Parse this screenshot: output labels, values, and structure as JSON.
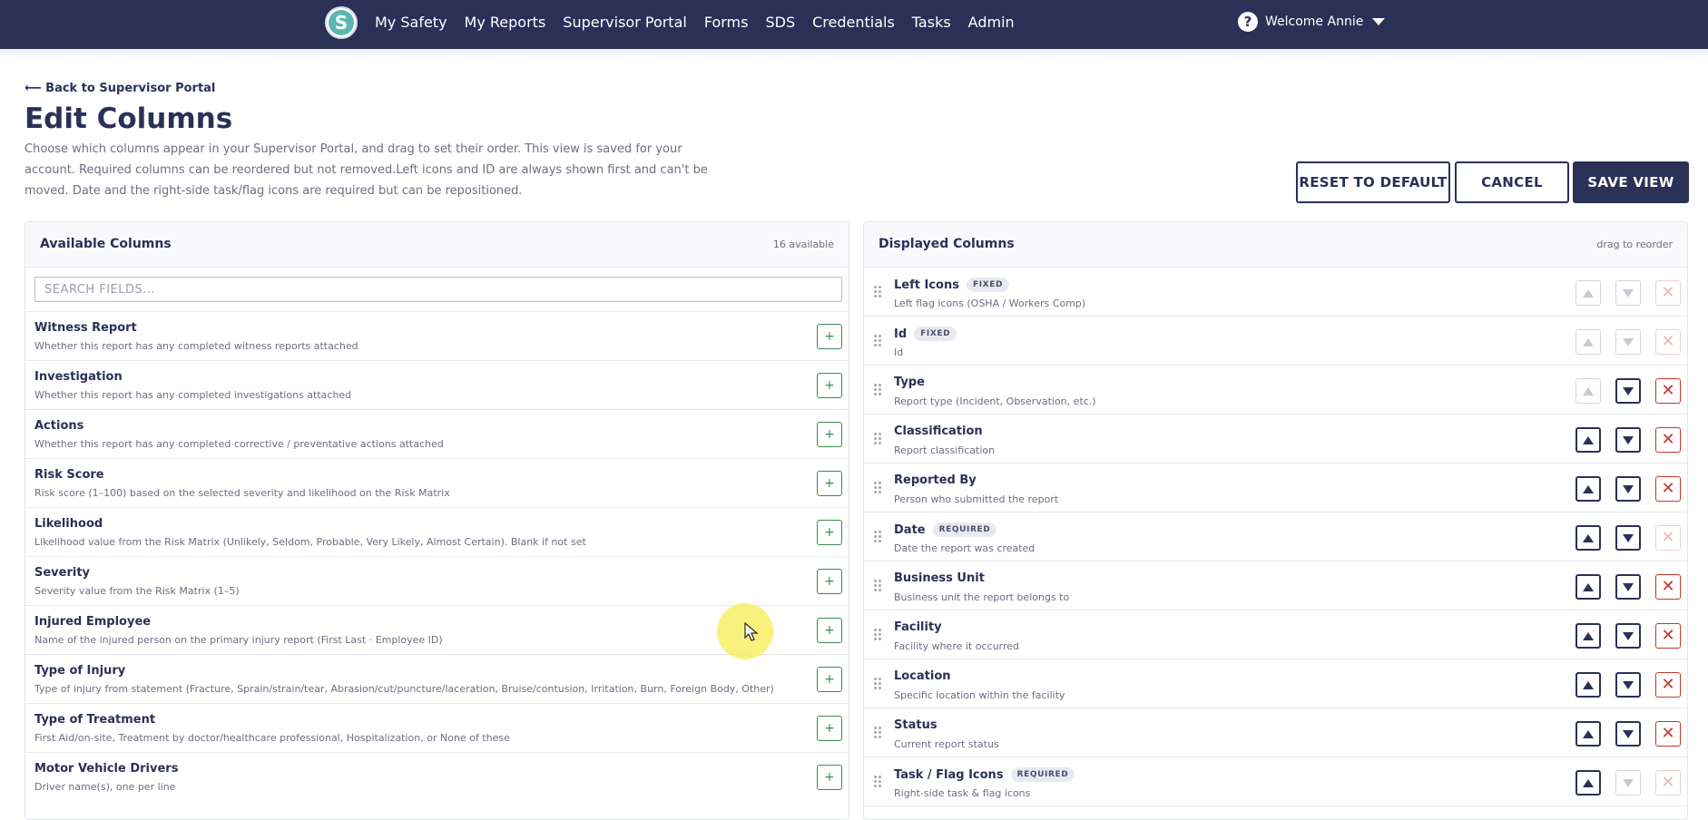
{
  "nav": {
    "logo_letter": "S",
    "links": [
      "My Safety",
      "My Reports",
      "Supervisor Portal",
      "Forms",
      "SDS",
      "Credentials",
      "Tasks",
      "Admin"
    ],
    "user_label": "Welcome Annie",
    "help_glyph": "?"
  },
  "header": {
    "back_label": "⟵ Back to Supervisor Portal",
    "title": "Edit Columns",
    "description": "Choose which columns appear in your Supervisor Portal, and drag to set their order. This view is saved for your account. Required columns can be reordered but not removed.Left icons and ID are always shown first and can't be moved. Date and the right-side task/flag icons are required but can be repositioned."
  },
  "actions": {
    "reset_label": "RESET TO DEFAULT",
    "cancel_label": "CANCEL",
    "save_label": "SAVE VIEW"
  },
  "available": {
    "title": "Available Columns",
    "count_label": "16 available",
    "search_placeholder": "SEARCH FIELDS...",
    "add_glyph": "+",
    "items": [
      {
        "title": "Witness Report",
        "desc": "Whether this report has any completed witness reports attached"
      },
      {
        "title": "Investigation",
        "desc": "Whether this report has any completed investigations attached"
      },
      {
        "title": "Actions",
        "desc": "Whether this report has any completed corrective / preventative actions attached"
      },
      {
        "title": "Risk Score",
        "desc": "Risk score (1–100) based on the selected severity and likelihood on the Risk Matrix"
      },
      {
        "title": "Likelihood",
        "desc": "Likelihood value from the Risk Matrix (Unlikely, Seldom, Probable, Very Likely, Almost Certain). Blank if not set"
      },
      {
        "title": "Severity",
        "desc": "Severity value from the Risk Matrix (1–5)"
      },
      {
        "title": "Injured Employee",
        "desc": "Name of the injured person on the primary injury report (First Last · Employee ID)"
      },
      {
        "title": "Type of Injury",
        "desc": "Type of injury from statement (Fracture, Sprain/strain/tear, Abrasion/cut/puncture/laceration, Bruise/contusion, Irritation, Burn, Foreign Body, Other)"
      },
      {
        "title": "Type of Treatment",
        "desc": "First Aid/on-site, Treatment by doctor/healthcare professional, Hospitalization, or None of these"
      },
      {
        "title": "Motor Vehicle Drivers",
        "desc": "Driver name(s), one per line"
      }
    ]
  },
  "displayed": {
    "title": "Displayed Columns",
    "hint": "drag to reorder",
    "remove_glyph": "✕",
    "items": [
      {
        "title": "Left Icons",
        "badge": "FIXED",
        "desc": "Left flag icons (OSHA / Workers Comp)",
        "up": false,
        "down": false,
        "remove": false
      },
      {
        "title": "Id",
        "badge": "FIXED",
        "desc": "Id",
        "up": false,
        "down": false,
        "remove": false
      },
      {
        "title": "Type",
        "badge": "",
        "desc": "Report type (Incident, Observation, etc.)",
        "up": false,
        "down": true,
        "remove": true
      },
      {
        "title": "Classification",
        "badge": "",
        "desc": "Report classification",
        "up": true,
        "down": true,
        "remove": true
      },
      {
        "title": "Reported By",
        "badge": "",
        "desc": "Person who submitted the report",
        "up": true,
        "down": true,
        "remove": true
      },
      {
        "title": "Date",
        "badge": "REQUIRED",
        "desc": "Date the report was created",
        "up": true,
        "down": true,
        "remove": false
      },
      {
        "title": "Business Unit",
        "badge": "",
        "desc": "Business unit the report belongs to",
        "up": true,
        "down": true,
        "remove": true
      },
      {
        "title": "Facility",
        "badge": "",
        "desc": "Facility where it occurred",
        "up": true,
        "down": true,
        "remove": true
      },
      {
        "title": "Location",
        "badge": "",
        "desc": "Specific location within the facility",
        "up": true,
        "down": true,
        "remove": true
      },
      {
        "title": "Status",
        "badge": "",
        "desc": "Current report status",
        "up": true,
        "down": true,
        "remove": true
      },
      {
        "title": "Task / Flag Icons",
        "badge": "REQUIRED",
        "desc": "Right-side task & flag icons",
        "up": true,
        "down": false,
        "remove": false
      }
    ]
  },
  "colors": {
    "nav_bg": "#2b3057",
    "primary": "#2b3057",
    "add_green": "#3f8a4e",
    "remove_red": "#c0392b"
  }
}
